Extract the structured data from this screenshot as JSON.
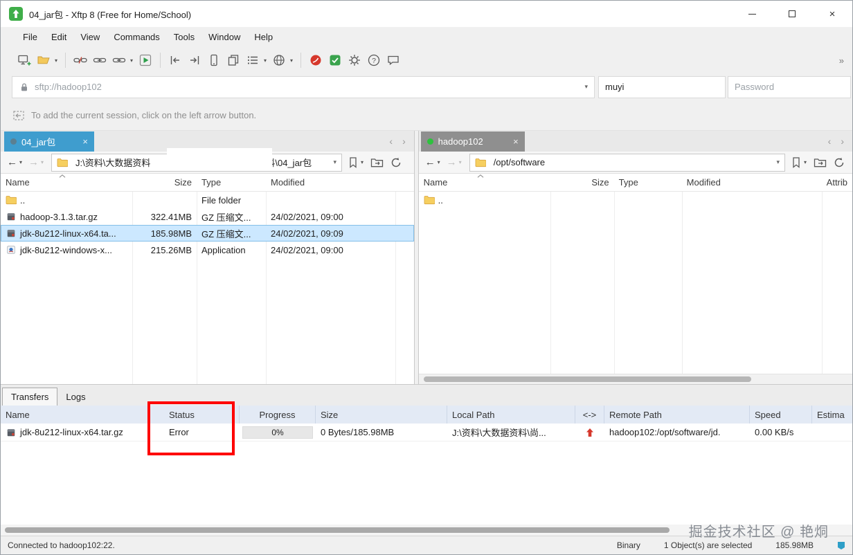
{
  "window": {
    "title": "04_jar包 - Xftp 8 (Free for Home/School)"
  },
  "menu": {
    "items": [
      "File",
      "Edit",
      "View",
      "Commands",
      "Tools",
      "Window",
      "Help"
    ]
  },
  "toolbar": {
    "icons": [
      "new-session",
      "open-folder",
      "disconnect",
      "reconnect",
      "connect-dropdown",
      "run",
      "transfer-left",
      "transfer-right",
      "mobile",
      "copy",
      "list-view",
      "web",
      "xshell",
      "xagent",
      "settings",
      "help",
      "feedback",
      "toolbar-overflow"
    ]
  },
  "address": {
    "url": "sftp://hadoop102",
    "username": "muyi",
    "password_placeholder": "Password"
  },
  "infobar": {
    "text": "To add the current session, click on the left arrow button."
  },
  "left_pane": {
    "tab": "04_jar包",
    "path_start": "J:\\资料\\大数据资料",
    "path_end": "资料\\04_jar包",
    "columns": [
      "Name",
      "Size",
      "Type",
      "Modified"
    ],
    "rows": [
      {
        "name": "..",
        "size": "",
        "type": "File folder",
        "modified": "",
        "icon": "folder"
      },
      {
        "name": "hadoop-3.1.3.tar.gz",
        "size": "322.41MB",
        "type": "GZ 压缩文...",
        "modified": "24/02/2021, 09:00",
        "icon": "archive"
      },
      {
        "name": "jdk-8u212-linux-x64.ta...",
        "size": "185.98MB",
        "type": "GZ 压缩文...",
        "modified": "24/02/2021, 09:09",
        "icon": "archive",
        "selected": true
      },
      {
        "name": "jdk-8u212-windows-x...",
        "size": "215.26MB",
        "type": "Application",
        "modified": "24/02/2021, 09:00",
        "icon": "app"
      }
    ]
  },
  "right_pane": {
    "tab": "hadoop102",
    "path": "/opt/software",
    "columns": [
      "Name",
      "Size",
      "Type",
      "Modified",
      "Attrib"
    ],
    "rows": [
      {
        "name": "..",
        "size": "",
        "type": "",
        "modified": "",
        "attrib": "",
        "icon": "folder"
      }
    ]
  },
  "transfers": {
    "tabs": [
      "Transfers",
      "Logs"
    ],
    "columns": [
      "Name",
      "Status",
      "Progress",
      "Size",
      "Local Path",
      "<->",
      "Remote Path",
      "Speed",
      "Estima"
    ],
    "rows": [
      {
        "name": "jdk-8u212-linux-x64.tar.gz",
        "status": "Error",
        "progress": "0%",
        "size": "0 Bytes/185.98MB",
        "local_path": "J:\\资料\\大数据资料\\尚...",
        "direction": "upload",
        "remote_path": "hadoop102:/opt/software/jd.",
        "speed": "0.00 KB/s",
        "estimated": ""
      }
    ]
  },
  "statusbar": {
    "connection": "Connected to hadoop102:22.",
    "mode": "Binary",
    "selection": "1 Object(s) are selected",
    "size": "185.98MB"
  },
  "watermark": {
    "text": "掘金技术社区 @ 艳烔"
  },
  "colors": {
    "active_tab": "#3f9dce",
    "inactive_tab": "#8f8f8f",
    "selection": "#cce8ff",
    "annotation": "#fe0000",
    "upload_arrow": "#d6382c",
    "connected_dot": "#2ec23e",
    "local_dot": "#5b7f91"
  }
}
